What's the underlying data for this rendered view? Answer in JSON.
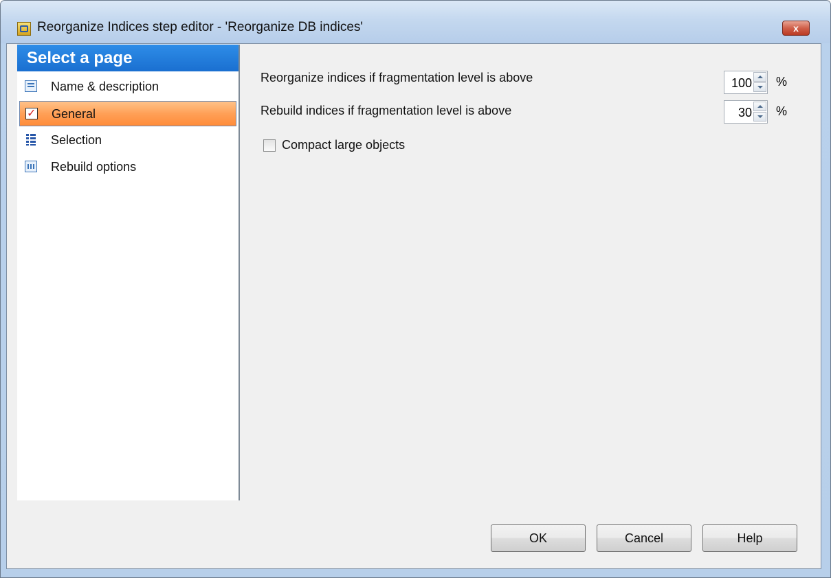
{
  "window": {
    "title": "Reorganize Indices step editor - 'Reorganize DB indices'",
    "close_label": "x"
  },
  "sidebar": {
    "header": "Select a page",
    "items": [
      {
        "label": "Name & description",
        "icon": "form-icon"
      },
      {
        "label": "General",
        "icon": "checkbox-icon",
        "selected": true
      },
      {
        "label": "Selection",
        "icon": "tree-icon"
      },
      {
        "label": "Rebuild options",
        "icon": "grid-icon"
      }
    ]
  },
  "general": {
    "reorganize_label": "Reorganize indices if fragmentation level is above",
    "reorganize_value": "100",
    "rebuild_label": "Rebuild indices if fragmentation level is above",
    "rebuild_value": "30",
    "unit": "%",
    "compact_label": "Compact large objects",
    "compact_checked": false
  },
  "buttons": {
    "ok": "OK",
    "cancel": "Cancel",
    "help": "Help"
  },
  "colors": {
    "selection_orange": "#ffa057",
    "header_blue": "#1a6fd0",
    "close_red": "#c94a33"
  }
}
